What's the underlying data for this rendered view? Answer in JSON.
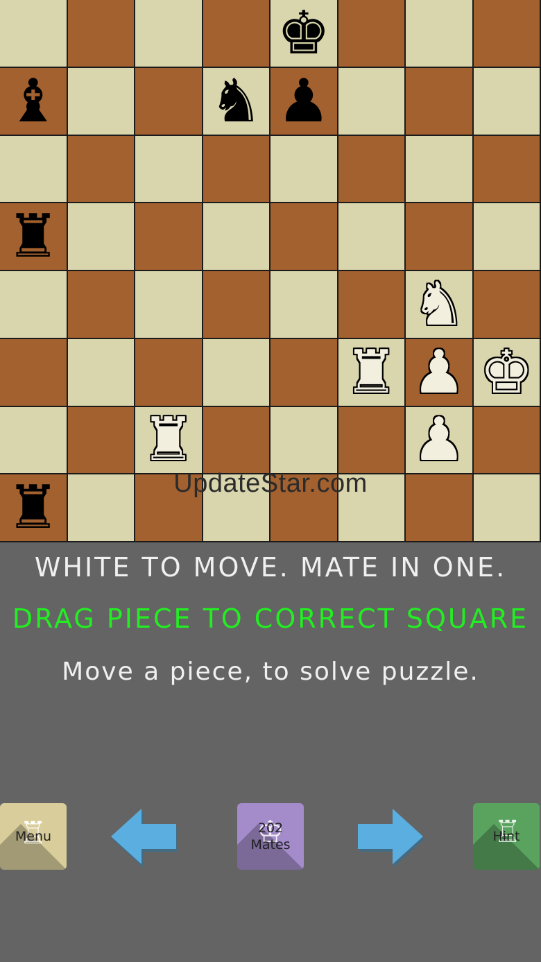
{
  "board": {
    "light_color": "#d9d5ac",
    "dark_color": "#a2612f",
    "rows": [
      [
        "",
        "",
        "",
        "",
        "bK",
        "",
        "",
        ""
      ],
      [
        "bB",
        "",
        "",
        "bN",
        "bP",
        "",
        "",
        ""
      ],
      [
        "",
        "",
        "",
        "",
        "",
        "",
        "",
        ""
      ],
      [
        "bR",
        "",
        "",
        "",
        "",
        "",
        "",
        ""
      ],
      [
        "",
        "",
        "",
        "",
        "",
        "",
        "wN",
        ""
      ],
      [
        "",
        "",
        "",
        "",
        "",
        "wR",
        "wP",
        "wK"
      ],
      [
        "",
        "",
        "wR",
        "",
        "",
        "",
        "wP",
        ""
      ],
      [
        "bR",
        "",
        "",
        "",
        "",
        "",
        "",
        ""
      ]
    ]
  },
  "watermark": "UpdateStar.com",
  "status": {
    "line1": "WHITE TO MOVE. MATE IN ONE.",
    "line2": "DRAG PIECE TO CORRECT SQUARE",
    "line3": "Move a piece, to solve puzzle."
  },
  "buttons": {
    "menu": {
      "label": "Menu",
      "color": "#d9ce9b",
      "icon": "rook-icon"
    },
    "prev": {
      "icon": "arrow-left-icon",
      "color": "#5aaee0"
    },
    "mates": {
      "label_line1": "202",
      "label_line2": "Mates",
      "color": "#a48ccb",
      "icon": "king-icon"
    },
    "next": {
      "icon": "arrow-right-icon",
      "color": "#5aaee0"
    },
    "hint": {
      "label": "Hint",
      "color": "#5aa35f",
      "icon": "rook-icon"
    }
  },
  "status_colors": {
    "text": "#f0f0f0",
    "highlight": "#22ee22"
  }
}
